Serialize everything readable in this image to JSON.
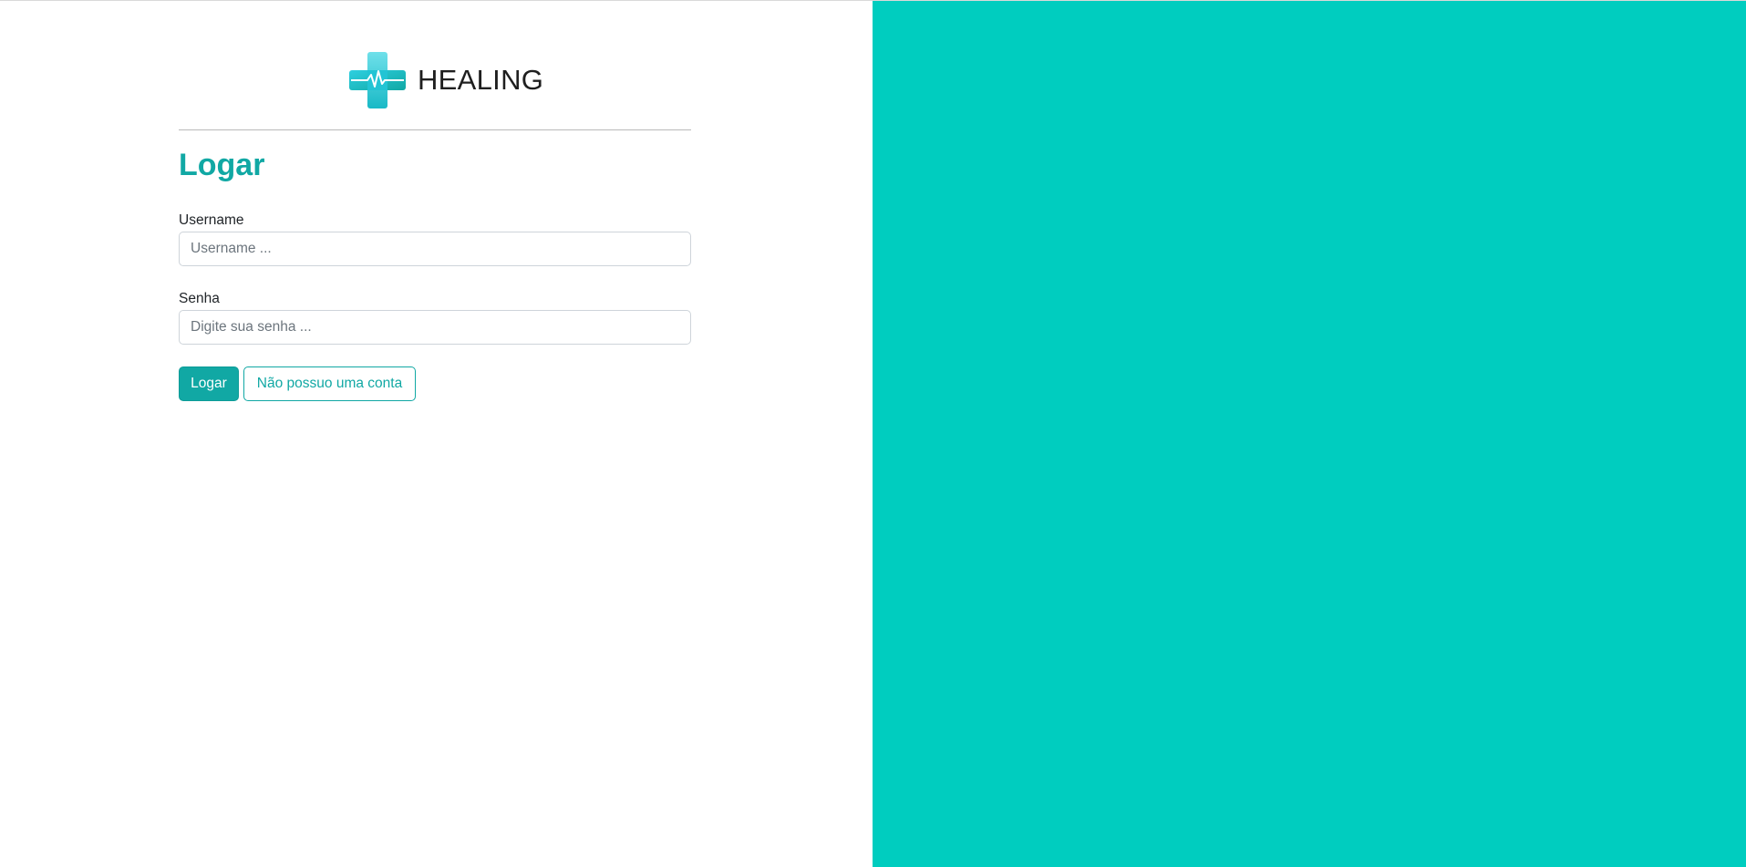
{
  "colors": {
    "accent": "#11a8a4",
    "accent_dark": "#0e9c98",
    "right_panel": "#00cdbf",
    "text": "#212529"
  },
  "brand": {
    "name": "HEALING",
    "logo_icon": "medical-cross-heartbeat-icon"
  },
  "form": {
    "title": "Logar",
    "username": {
      "label": "Username",
      "placeholder": "Username ...",
      "value": ""
    },
    "password": {
      "label": "Senha",
      "placeholder": "Digite sua senha ...",
      "value": ""
    },
    "login_button": "Logar",
    "no_account_button": "Não possuo uma conta"
  }
}
